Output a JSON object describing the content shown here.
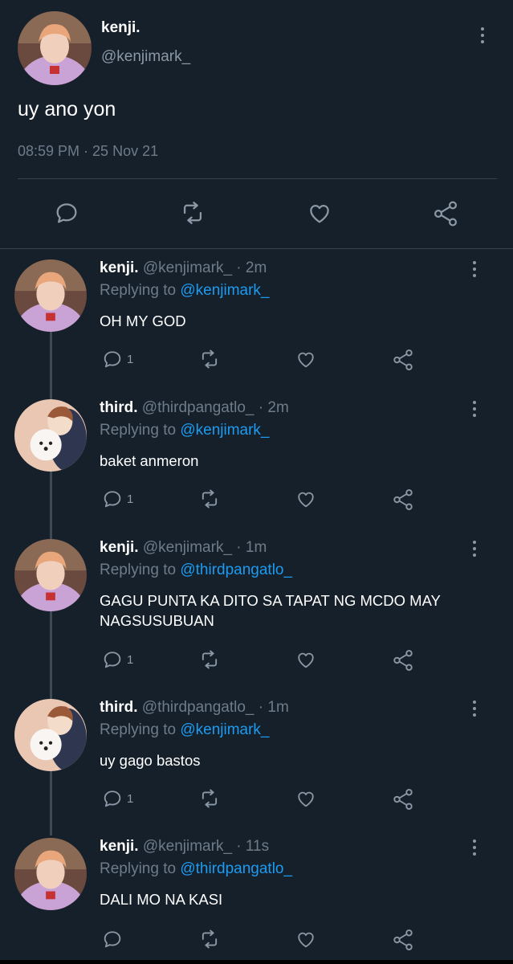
{
  "main_tweet": {
    "display_name": "kenji.",
    "handle": "@kenjimark_",
    "text": "uy ano yon",
    "timestamp": "08:59 PM · 25 Nov 21"
  },
  "replies": [
    {
      "display_name": "kenji.",
      "handle": "@kenjimark_",
      "time": "· 2m",
      "replying_prefix": "Replying to ",
      "replying_to": "@kenjimark_",
      "text": "OH MY GOD",
      "reply_count": "1",
      "avatar": "pink-hoodie"
    },
    {
      "display_name": "third.",
      "handle": "@thirdpangatlo_",
      "time": "· 2m",
      "replying_prefix": "Replying to ",
      "replying_to": "@kenjimark_",
      "text": "baket anmeron",
      "reply_count": "1",
      "avatar": "puppy"
    },
    {
      "display_name": "kenji.",
      "handle": "@kenjimark_",
      "time": "· 1m",
      "replying_prefix": "Replying to ",
      "replying_to": "@thirdpangatlo_",
      "text": "GAGU PUNTA KA DITO SA TAPAT NG MCDO MAY NAGSUSUBUAN",
      "reply_count": "1",
      "avatar": "pink-hoodie"
    },
    {
      "display_name": "third.",
      "handle": "@thirdpangatlo_",
      "time": "· 1m",
      "replying_prefix": "Replying to ",
      "replying_to": "@kenjimark_",
      "text": "uy gago bastos",
      "reply_count": "1",
      "avatar": "puppy"
    },
    {
      "display_name": "kenji.",
      "handle": "@kenjimark_",
      "time": "· 11s",
      "replying_prefix": "Replying to ",
      "replying_to": "@thirdpangatlo_",
      "text": "DALI MO NA KASI",
      "reply_count": "",
      "avatar": "pink-hoodie"
    }
  ],
  "colors": {
    "background": "#15202b",
    "accent": "#1d9bf0",
    "muted": "#8b98a5",
    "divider": "#38444d"
  },
  "icons": [
    "reply-icon",
    "retweet-icon",
    "like-icon",
    "share-icon",
    "more-icon"
  ]
}
